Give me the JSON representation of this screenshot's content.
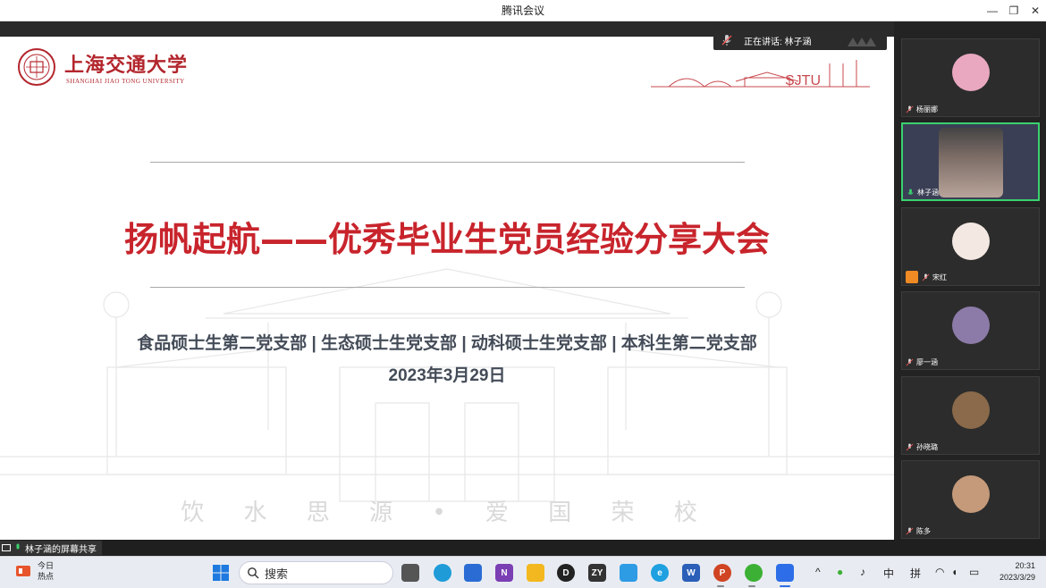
{
  "window": {
    "title": "腾讯会议"
  },
  "slide": {
    "university_cn": "上海交通大学",
    "university_en": "SHANGHAI JIAO TONG UNIVERSITY",
    "sjtu_mark": "SJTU",
    "title": "扬帆起航——优秀毕业生党员经验分享大会",
    "subtitle": "食品硕士生第二党支部 | 生态硕士生党支部 | 动科硕士生党支部 | 本科生第二党支部",
    "date": "2023年3月29日",
    "motto": "饮 水 思 源 • 爱 国 荣 校"
  },
  "speaking": {
    "label": "正在讲话: 林子涵"
  },
  "participants": [
    {
      "name": "杨丽娜",
      "mic": "muted",
      "avatar_color": "#e9a8c0",
      "active": false
    },
    {
      "name": "林子涵",
      "mic": "on",
      "avatar_color": "#6b5b55",
      "active": true
    },
    {
      "name": "宋红",
      "mic": "muted",
      "avatar_color": "#f4e8e2",
      "active": false
    },
    {
      "name": "廖一涵",
      "mic": "muted",
      "avatar_color": "#8c7ba8",
      "active": false
    },
    {
      "name": "孙晓璐",
      "mic": "muted",
      "avatar_color": "#8a6a4a",
      "active": false
    },
    {
      "name": "陈多",
      "mic": "muted",
      "avatar_color": "#c49a7a",
      "active": false
    }
  ],
  "share": {
    "label": "林子涵的屏幕共享"
  },
  "taskbar": {
    "news_line1": "今日",
    "news_line2": "热点",
    "search_placeholder": "搜索",
    "tray_ime_mode": "中",
    "tray_ime_name": "拼",
    "time": "20:31",
    "date": "2023/3/29"
  }
}
